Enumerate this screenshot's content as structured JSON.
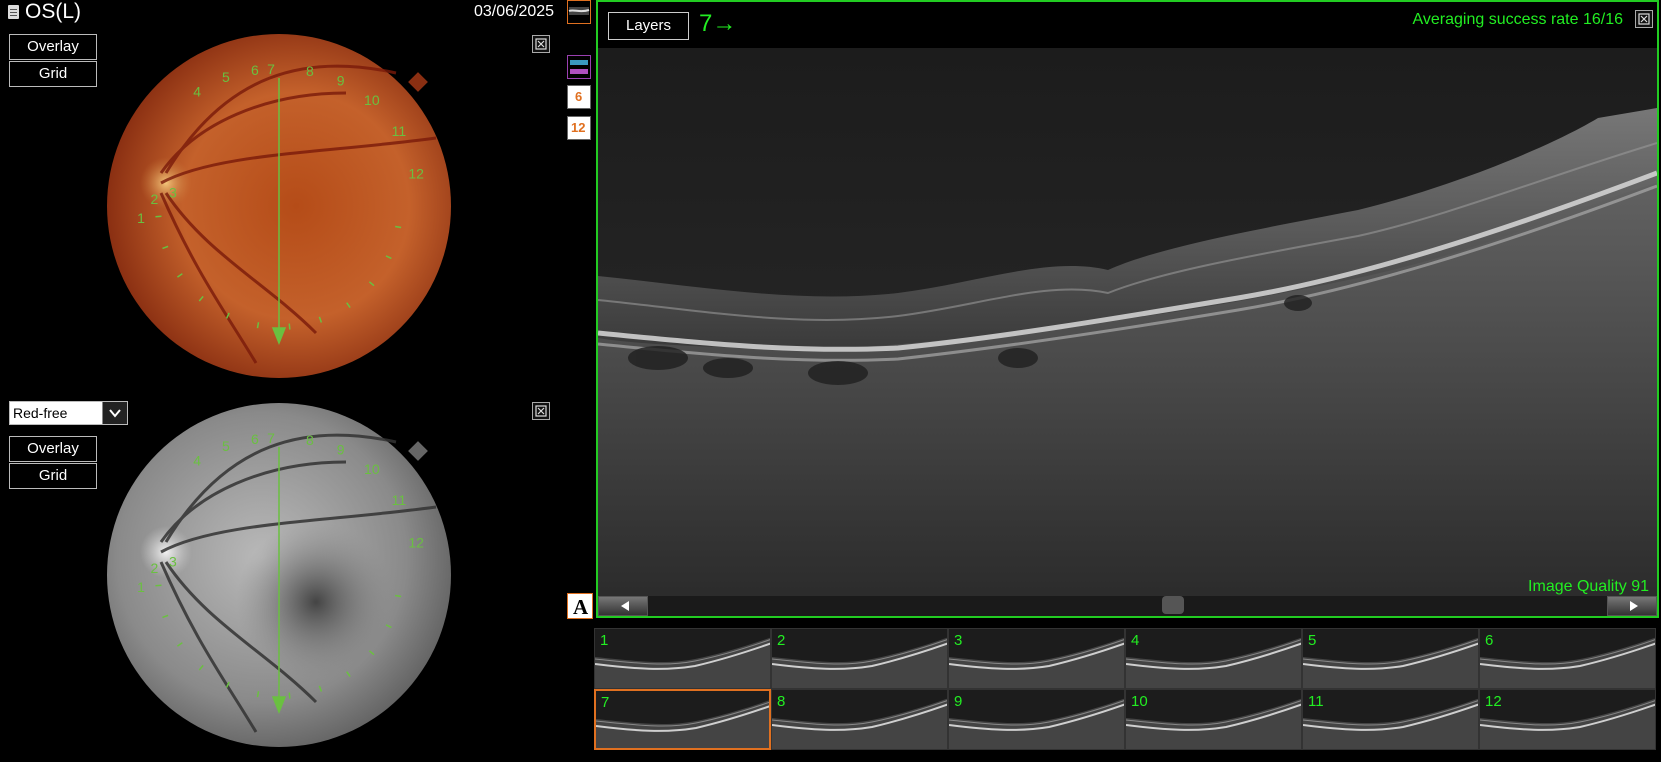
{
  "header": {
    "eye": "OS(L)",
    "date": "03/06/2025"
  },
  "top_fundus": {
    "overlay_label": "Overlay",
    "grid_label": "Grid"
  },
  "bottom_fundus": {
    "filter_selected": "Red-free",
    "overlay_label": "Overlay",
    "grid_label": "Grid"
  },
  "grid_numbers": [
    "1",
    "2",
    "3",
    "4",
    "5",
    "6",
    "7",
    "8",
    "9",
    "10",
    "11",
    "12"
  ],
  "side_tools": {
    "six_label": "6",
    "twelve_label": "12",
    "annotate_label": "A"
  },
  "oct": {
    "layers_label": "Layers",
    "scan_index": "7→",
    "averaging_text": "Averaging success rate 16/16",
    "quality_text": "Image Quality 91"
  },
  "thumbnails": [
    {
      "num": "1"
    },
    {
      "num": "2"
    },
    {
      "num": "3"
    },
    {
      "num": "4"
    },
    {
      "num": "5"
    },
    {
      "num": "6"
    },
    {
      "num": "7",
      "selected": true
    },
    {
      "num": "8"
    },
    {
      "num": "9"
    },
    {
      "num": "10"
    },
    {
      "num": "11"
    },
    {
      "num": "12"
    }
  ],
  "colors": {
    "accent_green": "#22ee22",
    "selection_orange": "#e07020",
    "overlay_green": "#6ac040"
  }
}
